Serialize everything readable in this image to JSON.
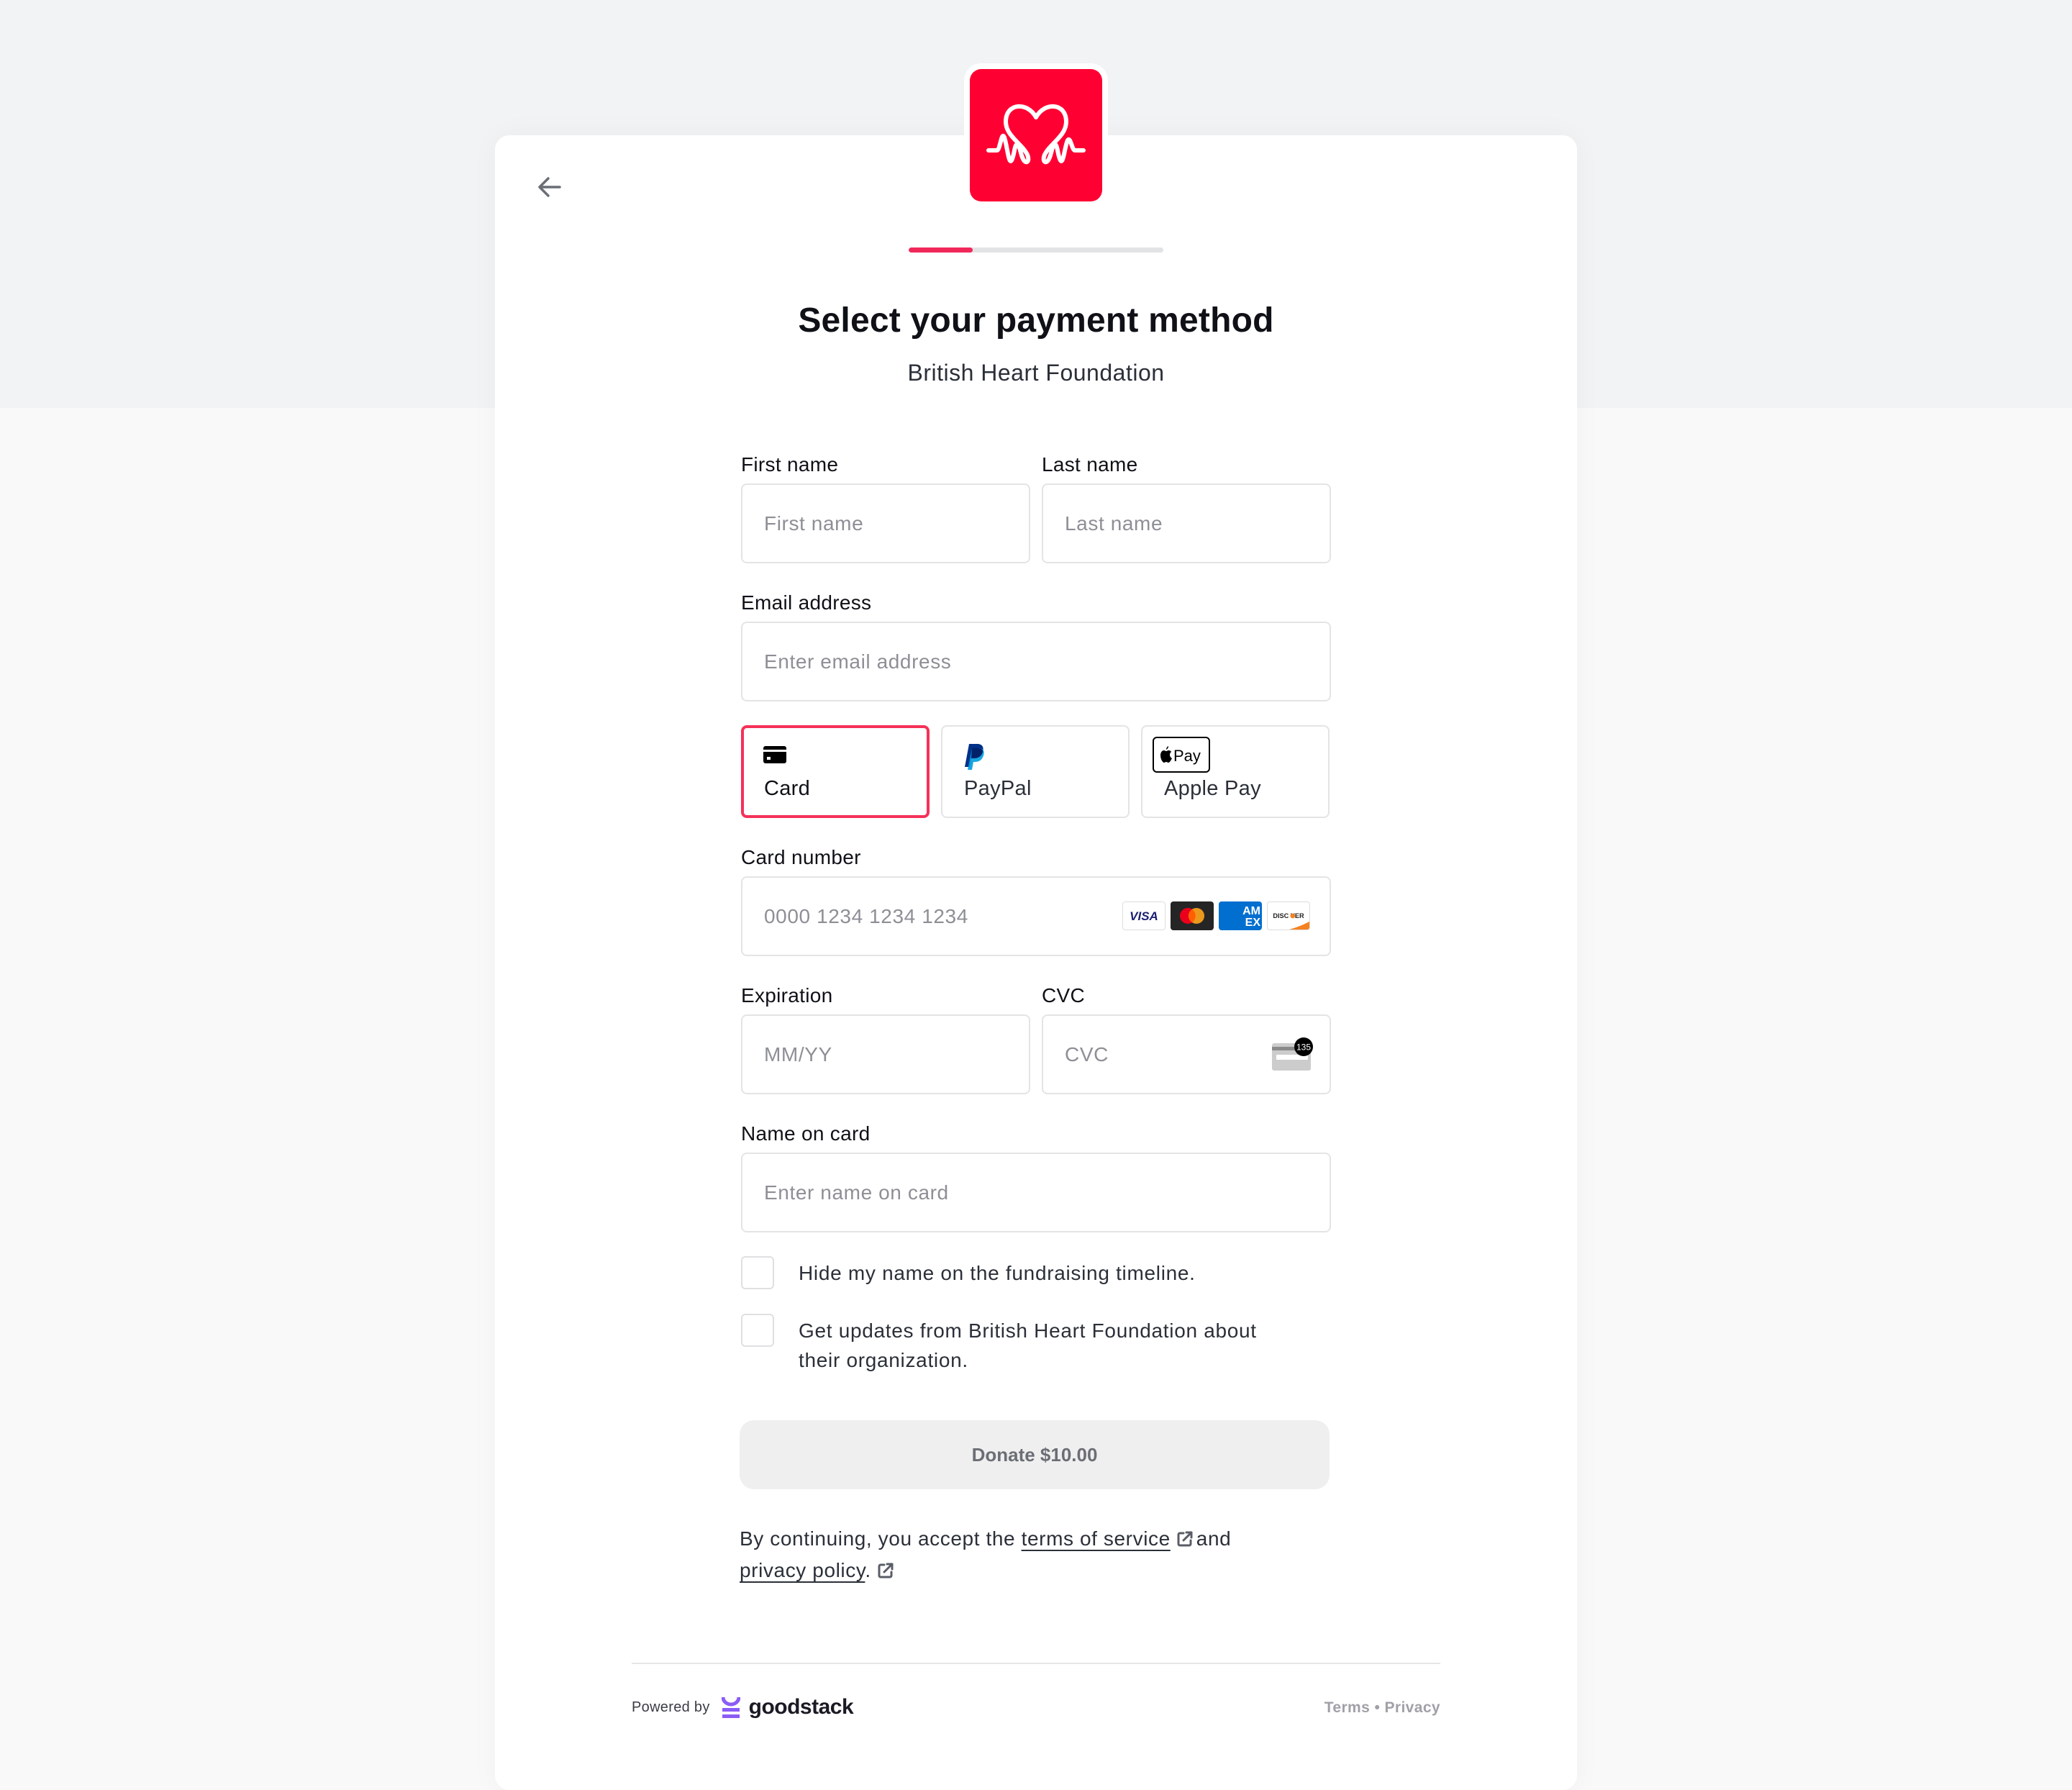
{
  "header": {
    "org_logo_alt": "British Heart Foundation logo",
    "back_icon": "arrow-left-icon",
    "progress": {
      "current_step": 1,
      "total_steps": 4,
      "fraction": 0.25
    },
    "title": "Select your payment method",
    "subtitle": "British Heart Foundation"
  },
  "colors": {
    "brand_red": "#FF0033",
    "accent": "#F0285A",
    "selected_border": "#F53158"
  },
  "form": {
    "first_name": {
      "label": "First name",
      "placeholder": "First name",
      "value": ""
    },
    "last_name": {
      "label": "Last name",
      "placeholder": "Last name",
      "value": ""
    },
    "email": {
      "label": "Email address",
      "placeholder": "Enter email address",
      "value": ""
    },
    "payment_methods": [
      {
        "label": "Card",
        "icon": "credit-card-icon",
        "selected": true
      },
      {
        "label": "PayPal",
        "icon": "paypal-icon",
        "selected": false
      },
      {
        "label": "Apple Pay",
        "icon": "apple-pay-icon",
        "selected": false
      }
    ],
    "card_number": {
      "label": "Card number",
      "placeholder": "0000 1234 1234 1234",
      "value": "",
      "brands": [
        "VISA",
        "Mastercard",
        "American Express",
        "DISCOVER"
      ]
    },
    "expiration": {
      "label": "Expiration",
      "placeholder": "MM/YY",
      "value": ""
    },
    "cvc": {
      "label": "CVC",
      "placeholder": "CVC",
      "value": "",
      "icon_number": "135"
    },
    "name_on_card": {
      "label": "Name on card",
      "placeholder": "Enter name on card",
      "value": ""
    },
    "checkboxes": [
      {
        "label": "Hide my name on the fundraising timeline.",
        "checked": false
      },
      {
        "label": "Get updates from British Heart Foundation about their organization.",
        "checked": false
      }
    ],
    "donate_label": "Donate $10.00"
  },
  "legal": {
    "prefix": "By continuing, you accept the",
    "terms_link": "terms of service",
    "middle": "and",
    "privacy_link": "privacy policy",
    "suffix": "."
  },
  "footer": {
    "powered_by": "Powered by",
    "brand": "goodstack",
    "terms": "Terms",
    "separator": "•",
    "privacy": "Privacy"
  }
}
